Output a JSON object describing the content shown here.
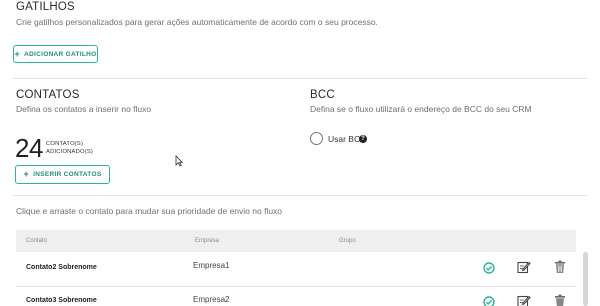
{
  "triggers": {
    "title": "GATILHOS",
    "subtitle": "Crie gatilhos personalizados para gerar ações automaticamente de acordo com o seu processo.",
    "add_button": "ADICIONAR GATILHO"
  },
  "contacts": {
    "title": "CONTATOS",
    "subtitle": "Defina os contatos a inserir no fluxo",
    "count": "24",
    "count_label_line1": "CONTATO(S)",
    "count_label_line2": "ADICIONADO(S)",
    "insert_button": "INSERIR CONTATOS"
  },
  "bcc": {
    "title": "BCC",
    "subtitle": "Defina se o fluxo utilizará o endereço de BCC do seu CRM",
    "option_label": "Usar BCC",
    "help": "?"
  },
  "priority_hint": "Clique e arraste o contato para mudar sua prioridade de envio no fluxo",
  "table": {
    "headers": [
      "Contato",
      "Empresa",
      "Grupo"
    ],
    "rows": [
      {
        "name": "Contato2 Sobrenome",
        "company": "Empresa1"
      },
      {
        "name": "Contato3 Sobrenome",
        "company": "Empresa2"
      }
    ]
  },
  "colors": {
    "accent": "#2bb59a",
    "check": "#2bb59a"
  }
}
